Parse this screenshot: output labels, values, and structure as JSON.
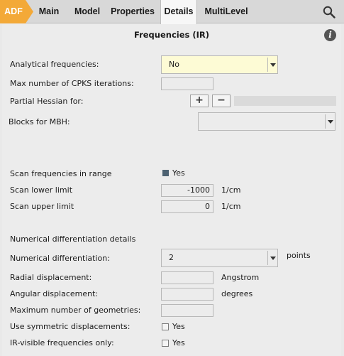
{
  "tabs": {
    "adf": "ADF",
    "main": "Main",
    "model": "Model",
    "properties": "Properties",
    "details": "Details",
    "multilevel": "MultiLevel"
  },
  "panel": {
    "title": "Frequencies (IR)",
    "info_glyph": "i"
  },
  "analytical": {
    "label": "Analytical frequencies:",
    "value": "No"
  },
  "cpks": {
    "label": "Max number of CPKS iterations:",
    "value": ""
  },
  "partial_hessian": {
    "label": "Partial Hessian for:",
    "add": "+",
    "remove": "−"
  },
  "blocks_mbh": {
    "label": "Blocks for MBH:",
    "value": ""
  },
  "scan": {
    "label": "Scan frequencies in range",
    "check_label": "Yes",
    "checked": true,
    "lower_label": "Scan lower limit",
    "lower_value": "-1000",
    "upper_label": "Scan upper limit",
    "upper_value": "0",
    "unit": "1/cm"
  },
  "numdiff": {
    "section": "Numerical differentiation details",
    "label": "Numerical differentiation:",
    "value": "2",
    "unit": "points",
    "radial_label": "Radial displacement:",
    "radial_unit": "Angstrom",
    "angular_label": "Angular displacement:",
    "angular_unit": "degrees",
    "maxgeo_label": "Maximum number of geometries:",
    "symm_label": "Use symmetric displacements:",
    "symm_check": "Yes",
    "ir_label": "IR-visible frequencies only:",
    "ir_check": "Yes"
  }
}
